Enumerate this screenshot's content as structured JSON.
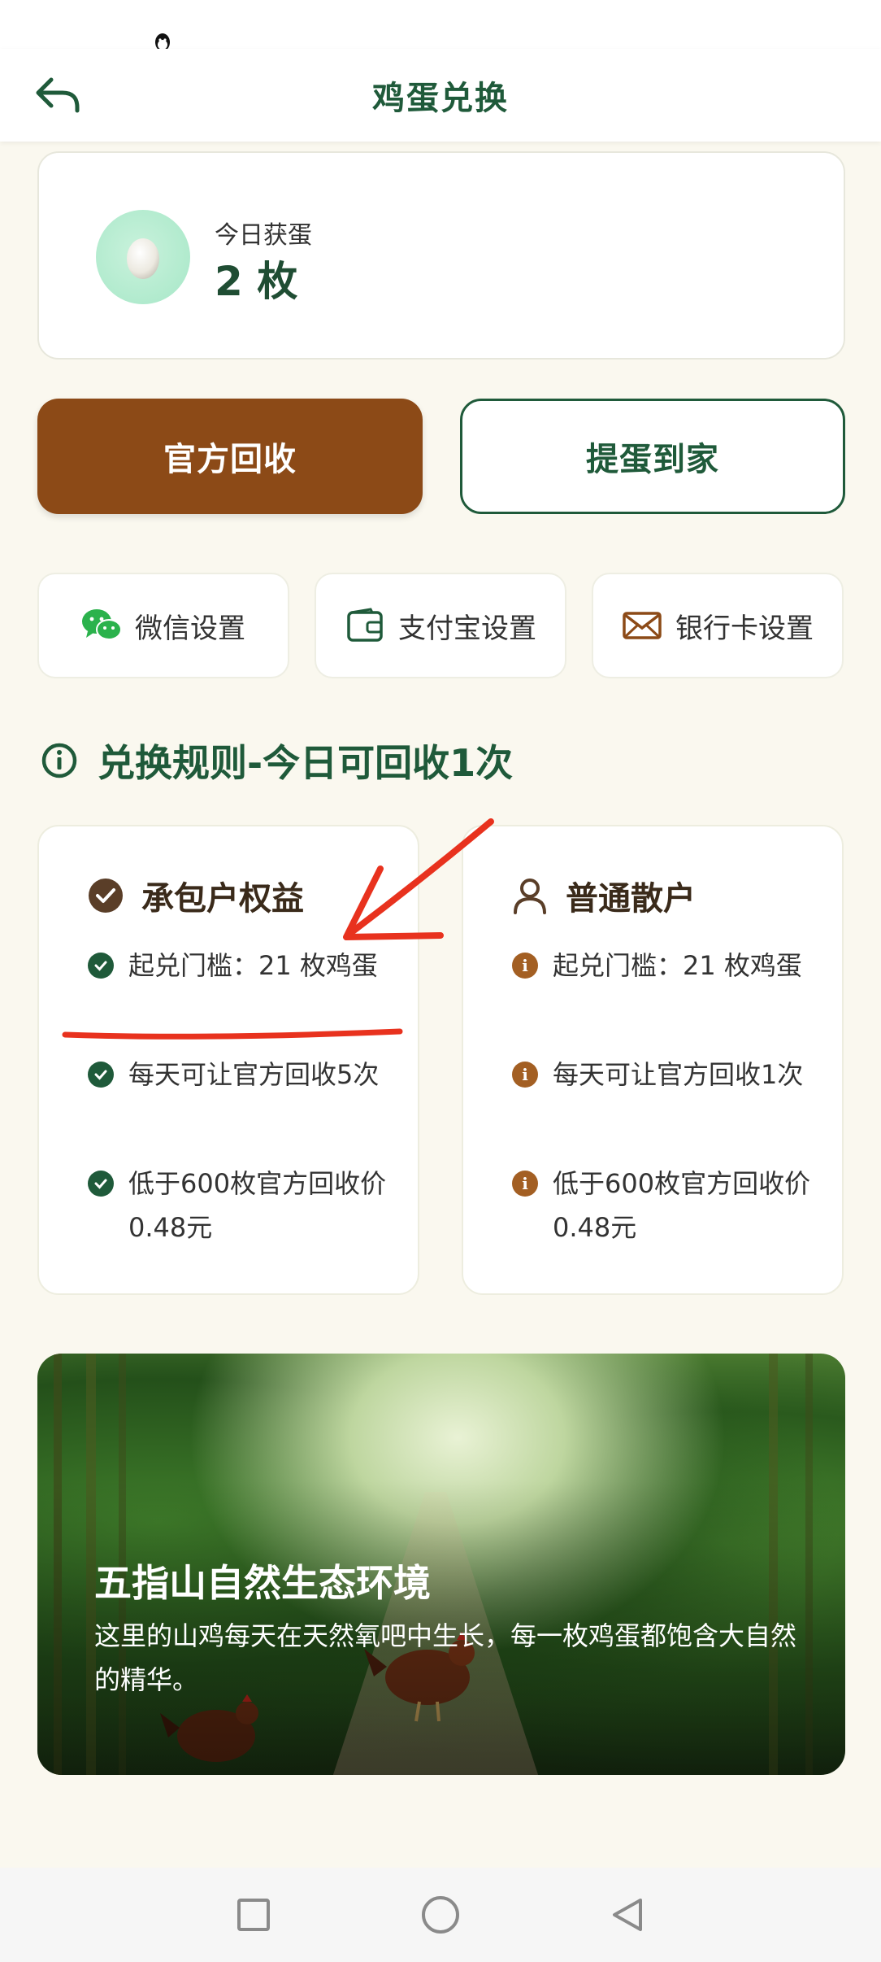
{
  "header": {
    "title": "鸡蛋兑换"
  },
  "egg_card": {
    "label": "今日获蛋",
    "count": "2 枚"
  },
  "actions": {
    "official": "官方回收",
    "home": "提蛋到家"
  },
  "settings": {
    "wechat": "微信设置",
    "alipay": "支付宝设置",
    "bank": "银行卡设置"
  },
  "rules": {
    "title": "兑换规则-今日可回收1次",
    "contractor": {
      "title": "承包户权益",
      "items": [
        "起兑门槛：21 枚鸡蛋",
        "每天可让官方回收5次",
        "低于600枚官方回收价0.48元"
      ]
    },
    "regular": {
      "title": "普通散户",
      "items": [
        "起兑门槛：21 枚鸡蛋",
        "每天可让官方回收1次",
        "低于600枚官方回收价0.48元"
      ]
    }
  },
  "banner": {
    "title": "五指山自然生态环境",
    "desc": "这里的山鸡每天在天然氧吧中生长，每一枚鸡蛋都饱含大自然的精华。"
  },
  "colors": {
    "primary_green": "#1f5a3a",
    "brown": "#8c4a17",
    "annotation_red": "#e8321e"
  }
}
